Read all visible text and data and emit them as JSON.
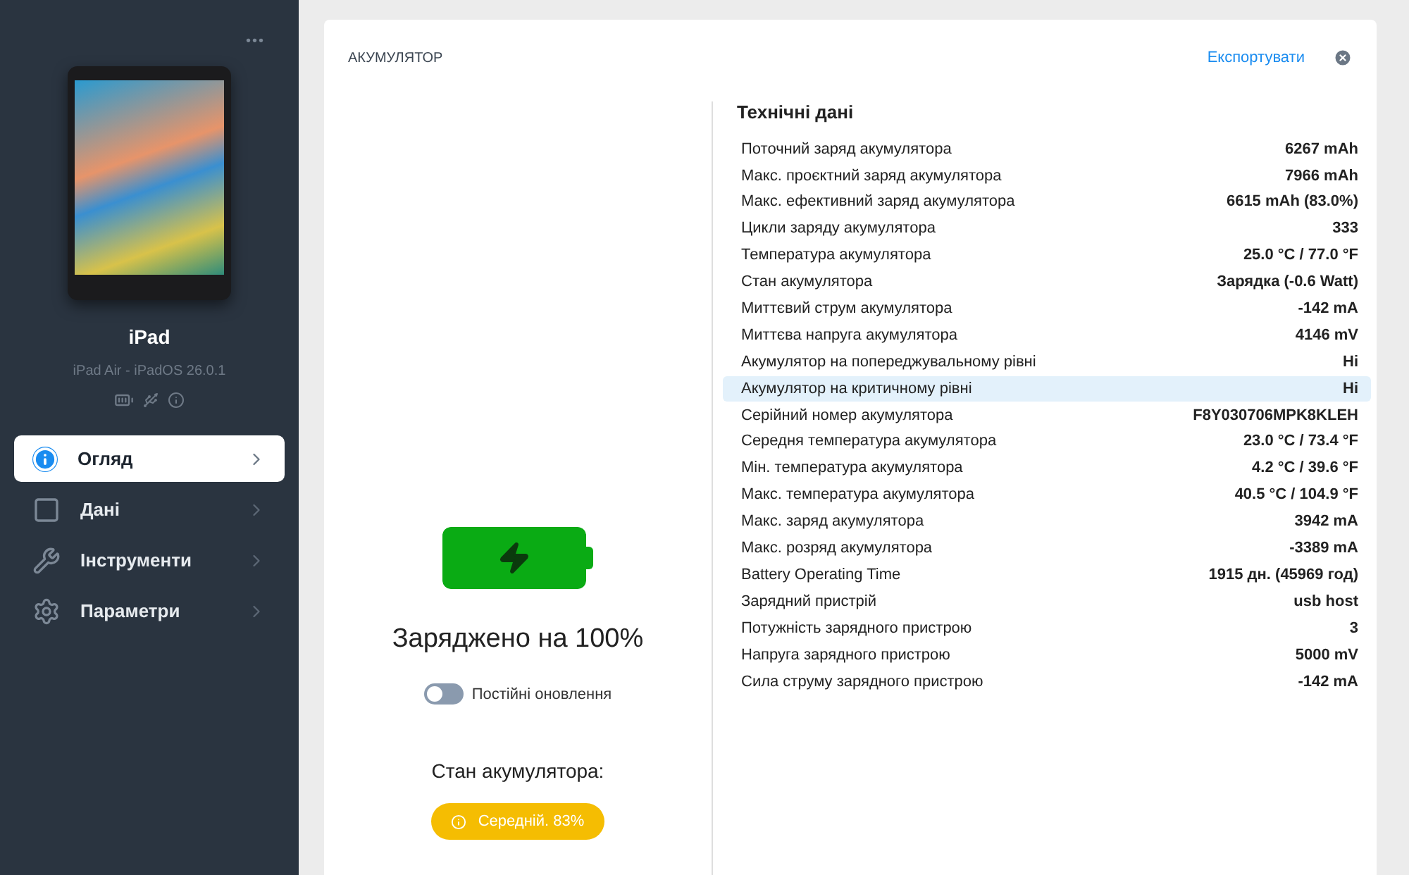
{
  "sidebar": {
    "more": "•••",
    "device": {
      "name": "iPad",
      "subtitle": "iPad Air - iPadOS 26.0.1"
    },
    "items": [
      {
        "label": "Огляд",
        "selected": true
      },
      {
        "label": "Дані",
        "selected": false
      },
      {
        "label": "Інструменти",
        "selected": false
      },
      {
        "label": "Параметри",
        "selected": false
      }
    ]
  },
  "panel": {
    "title": "АКУМУЛЯТОР",
    "export": "Експортувати",
    "battery": {
      "level": 1,
      "charging": true,
      "caption": "Заряджено на 100%"
    },
    "live_updates": {
      "label": "Постійні оновлення",
      "on": false
    },
    "health": {
      "label": "Стан акумулятора:",
      "badge": "Середній. 83%",
      "color": "#f5bd02"
    },
    "specs_title": "Технічні дані",
    "rows": [
      {
        "label": "Поточний заряд акумулятора",
        "value": "6267 mAh",
        "selected": false
      },
      {
        "label": "Макс. проєктний заряд акумулятора",
        "value": "7966 mAh",
        "selected": false
      },
      {
        "label": "Макс. ефективний заряд акумулятора",
        "value": "6615 mAh (83.0%)",
        "selected": false
      },
      {
        "label": "Цикли заряду акумулятора",
        "value": "333",
        "selected": false
      },
      {
        "label": "Температура акумулятора",
        "value": "25.0 °C / 77.0 °F",
        "selected": false
      },
      {
        "label": "Стан акумулятора",
        "value": "Зарядка (-0.6 Watt)",
        "selected": false
      },
      {
        "label": "Миттєвий струм акумулятора",
        "value": "-142 mA",
        "selected": false
      },
      {
        "label": "Миттєва напруга акумулятора",
        "value": "4146 mV",
        "selected": false
      },
      {
        "label": "Акумулятор на попереджувальному рівні",
        "value": "Ні",
        "selected": false
      },
      {
        "label": "Акумулятор на критичному рівні",
        "value": "Ні",
        "selected": true
      },
      {
        "label": "Серійний номер акумулятора",
        "value": "F8Y030706MPK8KLEH",
        "selected": false
      },
      {
        "label": "Середня температура акумулятора",
        "value": "23.0 °C / 73.4 °F",
        "selected": false
      },
      {
        "label": "Мін. температура акумулятора",
        "value": "4.2 °C / 39.6 °F",
        "selected": false
      },
      {
        "label": "Макс. температура акумулятора",
        "value": "40.5 °C / 104.9 °F",
        "selected": false
      },
      {
        "label": "Макс. заряд акумулятора",
        "value": "3942 mA",
        "selected": false
      },
      {
        "label": "Макс. розряд акумулятора",
        "value": "-3389 mA",
        "selected": false
      },
      {
        "label": "Battery Operating Time",
        "value": "1915 дн. (45969 год)",
        "selected": false
      },
      {
        "label": "Зарядний пристрій",
        "value": "usb host",
        "selected": false
      },
      {
        "label": "Потужність зарядного пристрою",
        "value": "3",
        "selected": false
      },
      {
        "label": "Напруга зарядного пристрою",
        "value": "5000 mV",
        "selected": false
      },
      {
        "label": "Сила струму зарядного пристрою",
        "value": "-142 mA",
        "selected": false
      }
    ]
  }
}
